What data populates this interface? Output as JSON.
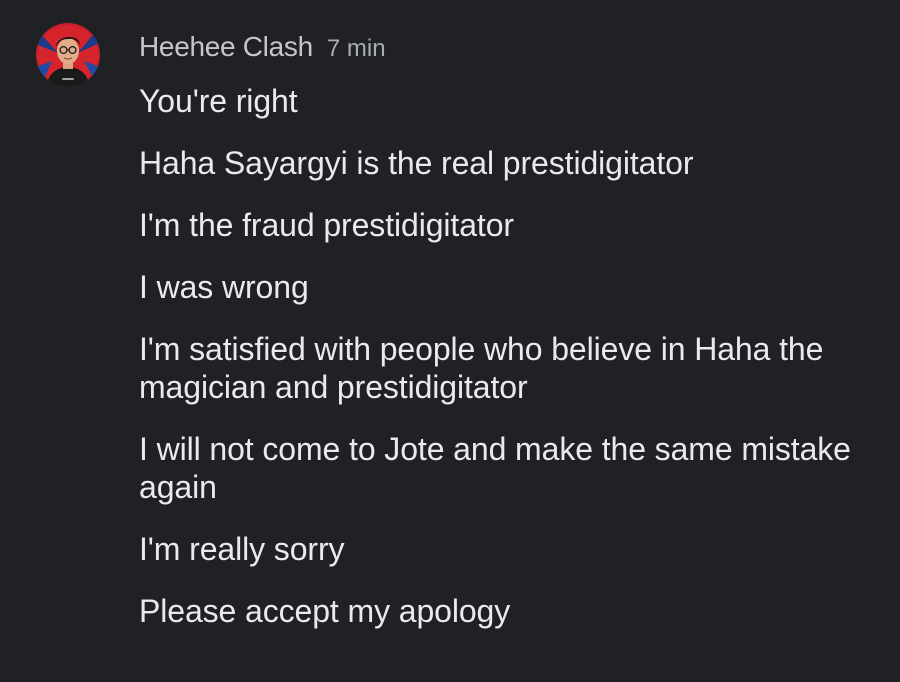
{
  "comment": {
    "author": "Heehee Clash",
    "timestamp": "7 min",
    "avatar_icon": "user-avatar-icon",
    "messages": [
      "You're right",
      "Haha Sayargyi is the real prestidigitator",
      "I'm the fraud prestidigitator",
      "I was wrong",
      "I'm satisfied with people who believe in Haha the magician and prestidigitator",
      "I will not come to Jote and make the same mistake again",
      "I'm really sorry",
      "Please accept my apology"
    ]
  },
  "colors": {
    "background": "#202124",
    "author_text": "#c4c6ca",
    "timestamp_text": "#aaadb1",
    "message_text": "#e8eaed",
    "avatar_red": "#c8202a"
  }
}
